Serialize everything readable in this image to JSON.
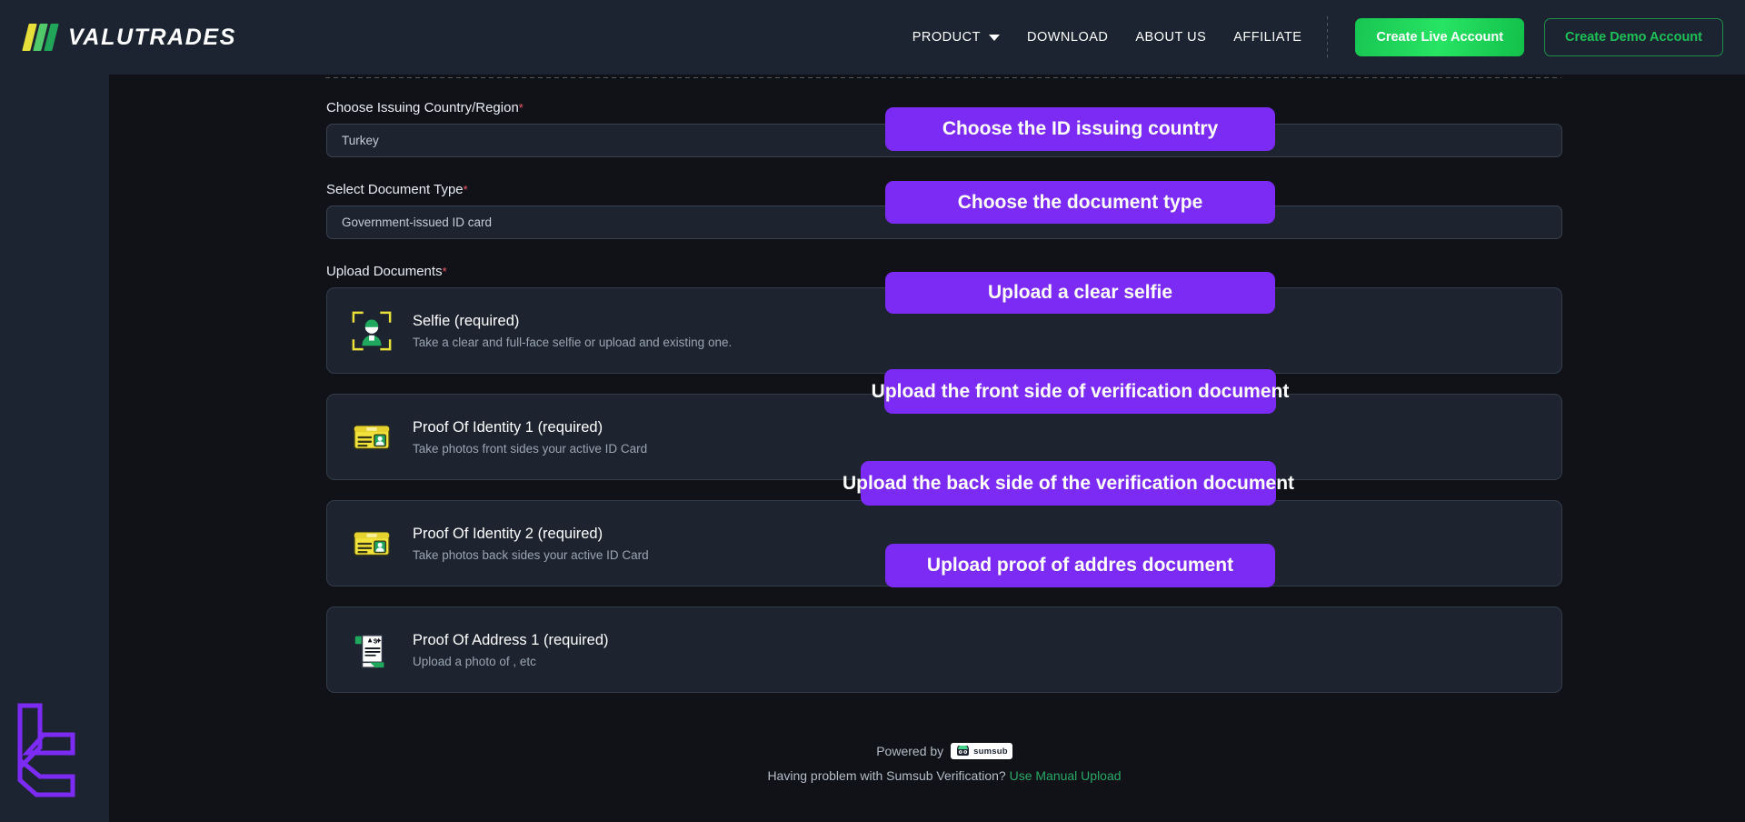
{
  "header": {
    "brand_name": "VALUTRADES",
    "nav_items": [
      {
        "label": "PRODUCT",
        "has_caret": true,
        "icon": "chevron-down-icon"
      },
      {
        "label": "DOWNLOAD",
        "has_caret": false
      },
      {
        "label": "ABOUT US",
        "has_caret": false
      },
      {
        "label": "AFFILIATE",
        "has_caret": false
      }
    ],
    "live_button": "Create Live Account",
    "demo_button": "Create Demo Account",
    "colors": {
      "nav_bg": "#1b2430",
      "live_green": "#27e463",
      "demo_green": "#1fbf58"
    }
  },
  "form": {
    "country": {
      "label": "Choose Issuing Country/Region",
      "required_mark": "*",
      "value": "Turkey"
    },
    "document_type": {
      "label": "Select Document Type",
      "required_mark": "*",
      "value": "Government-issued ID card"
    },
    "upload_documents": {
      "label": "Upload Documents",
      "required_mark": "*"
    },
    "cards": [
      {
        "icon": "selfie-frame-icon",
        "title": "Selfie (required)",
        "subtitle": "Take a clear and full-face selfie or upload and existing one."
      },
      {
        "icon": "id-card-icon",
        "title": "Proof Of Identity 1 (required)",
        "subtitle": "Take photos front sides your active ID Card"
      },
      {
        "icon": "id-card-icon",
        "title": "Proof Of Identity 2 (required)",
        "subtitle": "Take photos back sides your active ID Card"
      },
      {
        "icon": "address-document-icon",
        "title": "Proof Of Address 1 (required)",
        "subtitle": "Upload a photo of , etc"
      }
    ]
  },
  "footer": {
    "powered_by": "Powered by",
    "provider_name": "sumsub",
    "help_text": "Having problem with Sumsub Verification?",
    "help_link": "Use Manual Upload",
    "link_color": "#2aa866"
  },
  "annotations": {
    "color": "#7c2bf5",
    "items": [
      {
        "text": "Choose the ID issuing country"
      },
      {
        "text": "Choose the document type"
      },
      {
        "text": "Upload a clear selfie"
      },
      {
        "text": "Upload the front side of verification document"
      },
      {
        "text": "Upload the back side of the verification document"
      },
      {
        "text": "Upload proof of addres document"
      }
    ]
  }
}
